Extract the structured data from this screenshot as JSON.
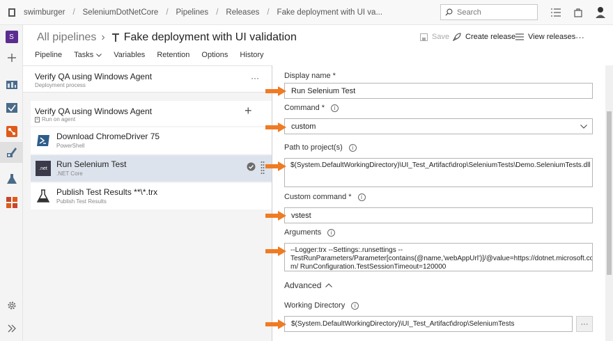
{
  "breadcrumb": [
    "swimburger",
    "SeleniumDotNetCore",
    "Pipelines",
    "Releases",
    "Fake deployment with UI va..."
  ],
  "search": {
    "placeholder": "Search"
  },
  "header": {
    "all_pipelines": "All pipelines",
    "title": "Fake deployment with UI validation",
    "save": "Save",
    "create_release": "Create release",
    "view_releases": "View releases",
    "more": "···"
  },
  "tabs": [
    {
      "label": "Pipeline"
    },
    {
      "label": "Tasks"
    },
    {
      "label": "Variables"
    },
    {
      "label": "Retention"
    },
    {
      "label": "Options"
    },
    {
      "label": "History"
    }
  ],
  "rail": {
    "project_initial": "S"
  },
  "stage": {
    "name": "Verify QA using Windows Agent",
    "sub": "Deployment process",
    "more": "···"
  },
  "job": {
    "name": "Verify QA using Windows Agent",
    "sub": "Run on agent",
    "add": "+"
  },
  "tasks": [
    {
      "name": "Download ChromeDriver 75",
      "sub": "PowerShell"
    },
    {
      "name": "Run Selenium Test",
      "sub": ".NET Core",
      "icon_text": ".net"
    },
    {
      "name": "Publish Test Results **\\*.trx",
      "sub": "Publish Test Results"
    }
  ],
  "form": {
    "display_name": {
      "label": "Display name",
      "required": "*",
      "value": "Run Selenium Test"
    },
    "command": {
      "label": "Command",
      "required": "*",
      "value": "custom"
    },
    "path": {
      "label": "Path to project(s)",
      "value": "$(System.DefaultWorkingDirectory)\\UI_Test_Artifact\\drop\\SeleniumTests\\Demo.SeleniumTests.dll"
    },
    "custom_command": {
      "label": "Custom command",
      "required": "*",
      "value": "vstest"
    },
    "arguments": {
      "label": "Arguments",
      "line1": "--Logger:trx --Settings:.runsettings --",
      "line2": "TestRunParameters/Parameter[contains(@name,'webAppUrl')]/@value=https://dotnet.microsoft.co",
      "line3": "m/ RunConfiguration.TestSessionTimeout=120000"
    },
    "advanced": {
      "label": "Advanced"
    },
    "working_dir": {
      "label": "Working Directory",
      "value": "$(System.DefaultWorkingDirectory)\\UI_Test_Artifact\\drop\\SeleniumTests",
      "browse": "···"
    }
  },
  "colors": {
    "accent": "#0078d4",
    "arrow": "#ef7b24",
    "selected_row": "#dde3ec",
    "project_badge": "#5c2d91"
  }
}
